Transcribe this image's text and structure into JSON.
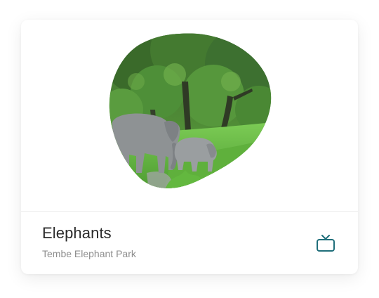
{
  "card": {
    "title": "Elephants",
    "subtitle": "Tembe Elephant Park",
    "image": {
      "subject": "elephants-in-grassland",
      "shape": "organic-blob"
    },
    "action_icon": "tv-icon"
  },
  "colors": {
    "accent": "#1f6e7a",
    "title": "#2a2a2a",
    "subtitle": "#8e8e8e",
    "foliage_dark": "#2f5a25",
    "foliage_mid": "#4d8a35",
    "grass": "#6cc04a",
    "elephant": "#8e9294"
  }
}
